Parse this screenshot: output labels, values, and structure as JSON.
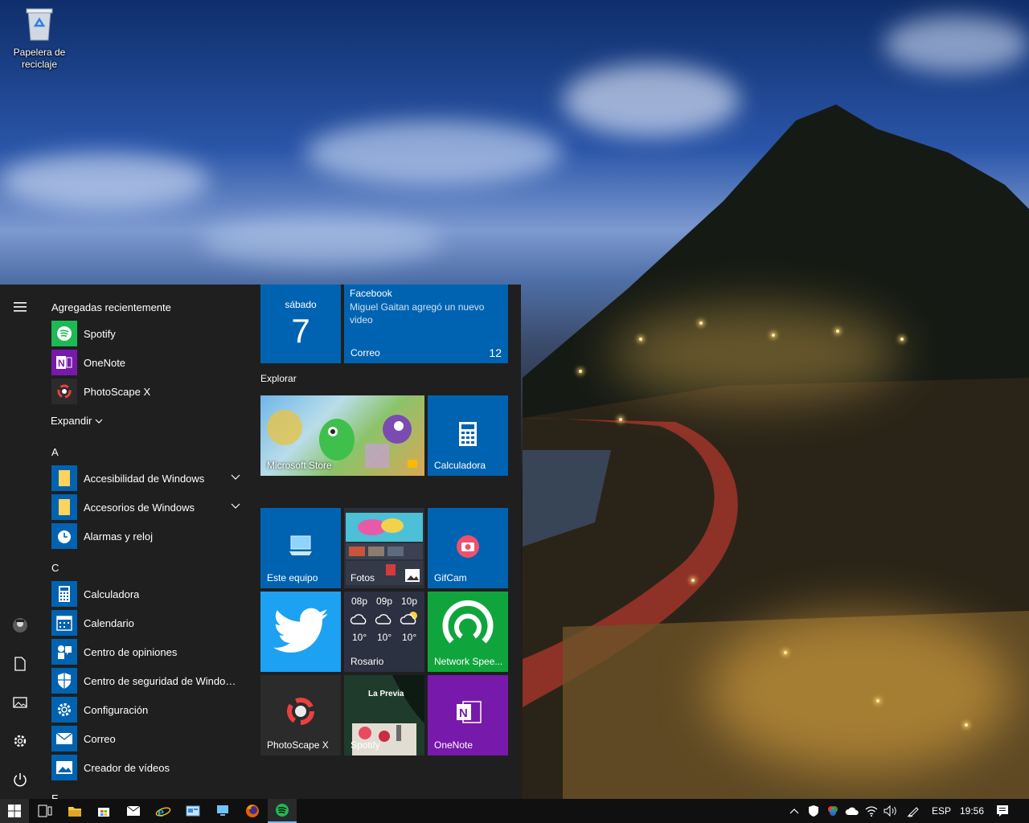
{
  "desktop": {
    "icons": [
      {
        "label": "Papelera de reciclaje",
        "icon": "recycle-bin-icon"
      }
    ]
  },
  "start_menu": {
    "rail": {
      "icons": [
        "hamburger-menu-icon",
        "user-avatar-icon",
        "documents-icon",
        "pictures-icon",
        "settings-gear-icon",
        "power-icon"
      ]
    },
    "recent_header": "Agregadas recientemente",
    "recent_apps": [
      {
        "label": "Spotify",
        "color": "#1db954",
        "icon": "spotify-icon"
      },
      {
        "label": "OneNote",
        "color": "#7719aa",
        "icon": "onenote-icon"
      },
      {
        "label": "PhotoScape X",
        "color": "#2b2b2b",
        "icon": "photoscape-icon"
      }
    ],
    "expand_label": "Expandir",
    "letter_a": "A",
    "apps_a": [
      {
        "label": "Accesibilidad de Windows",
        "color": "#0063b1",
        "icon": "folder-icon",
        "expandable": true
      },
      {
        "label": "Accesorios de Windows",
        "color": "#0063b1",
        "icon": "folder-icon",
        "expandable": true
      },
      {
        "label": "Alarmas y reloj",
        "color": "#0063b1",
        "icon": "alarm-clock-icon",
        "expandable": false
      }
    ],
    "letter_c": "C",
    "apps_c": [
      {
        "label": "Calculadora",
        "color": "#0063b1",
        "icon": "calculator-icon"
      },
      {
        "label": "Calendario",
        "color": "#0063b1",
        "icon": "calendar-icon"
      },
      {
        "label": "Centro de opiniones",
        "color": "#0063b1",
        "icon": "feedback-hub-icon"
      },
      {
        "label": "Centro de seguridad de Windows D...",
        "color": "#0063b1",
        "icon": "shield-icon"
      },
      {
        "label": "Configuración",
        "color": "#0063b1",
        "icon": "settings-gear-icon"
      },
      {
        "label": "Correo",
        "color": "#0063b1",
        "icon": "mail-icon"
      },
      {
        "label": "Creador de vídeos",
        "color": "#0063b1",
        "icon": "video-editor-icon"
      }
    ],
    "letter_partial": "E"
  },
  "tiles": {
    "calendar": {
      "day": "sábado",
      "date": "7"
    },
    "mail": {
      "title": "Facebook",
      "message": "Miguel Gaitan agregó un nuevo video",
      "app": "Correo",
      "count": "12"
    },
    "group_label": "Explorar",
    "store": {
      "label": "Microsoft Store"
    },
    "calculadora": {
      "label": "Calculadora"
    },
    "este_equipo": {
      "label": "Este equipo"
    },
    "fotos": {
      "label": "Fotos"
    },
    "gifcam": {
      "label": "GifCam"
    },
    "twitter": {
      "label": ""
    },
    "weather": {
      "hours": [
        "08p",
        "09p",
        "10p"
      ],
      "temps": [
        "10°",
        "10°",
        "10°"
      ],
      "city": "Rosario"
    },
    "network_speed": {
      "label": "Network Spee..."
    },
    "photoscape": {
      "label": "PhotoScape X"
    },
    "spotify": {
      "label": "Spotify",
      "promo": "La Previa"
    },
    "onenote": {
      "label": "OneNote"
    }
  },
  "colors": {
    "tile_blue": "#0063b1",
    "twitter_blue": "#1da1f2",
    "network_green": "#10a53c",
    "onenote_purple": "#7719aa",
    "start_bg": "#1f1f1f",
    "taskbar_bg": "#101010"
  },
  "taskbar": {
    "pinned": [
      "windows-start-icon",
      "task-view-icon",
      "file-explorer-icon",
      "microsoft-store-icon",
      "mail-icon",
      "internet-explorer-icon",
      "control-panel-icon",
      "this-pc-icon",
      "firefox-icon",
      "spotify-icon"
    ],
    "language": "ESP",
    "time": "19:56"
  }
}
